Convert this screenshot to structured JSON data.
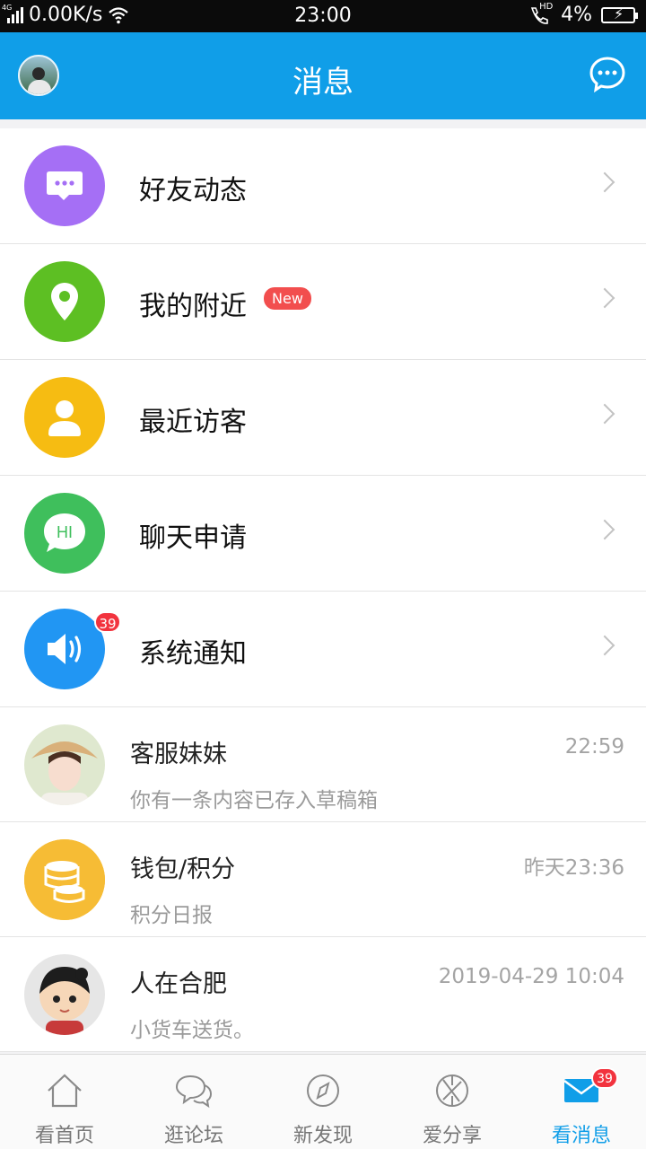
{
  "status_bar": {
    "network": "4G",
    "speed": "0.00K/s",
    "time": "23:00",
    "hd": "HD",
    "battery": "4%"
  },
  "header": {
    "title": "消息",
    "left_icon": "avatar",
    "right_icon": "chat-bubble-icon"
  },
  "features": [
    {
      "label": "好友动态",
      "icon": "speech-bubble-icon",
      "color": "#a56ff5"
    },
    {
      "label": "我的附近",
      "icon": "location-pin-icon",
      "color": "#5dbf23",
      "badge": "New"
    },
    {
      "label": "最近访客",
      "icon": "person-icon",
      "color": "#f6bc12"
    },
    {
      "label": "聊天申请",
      "icon": "hi-bubble-icon",
      "color": "#3fbf5c",
      "icon_text": "HI"
    },
    {
      "label": "系统通知",
      "icon": "speaker-icon",
      "color": "#2196f3",
      "badge": "39"
    }
  ],
  "messages": [
    {
      "name": "客服妹妹",
      "preview": "你有一条内容已存入草稿箱",
      "time": "22:59"
    },
    {
      "name": "钱包/积分",
      "preview": "积分日报",
      "time": "昨天23:36"
    },
    {
      "name": "人在合肥",
      "preview": "小货车送货。",
      "time": "2019-04-29 10:04"
    }
  ],
  "tabs": [
    {
      "label": "看首页",
      "icon": "home-icon"
    },
    {
      "label": "逛论坛",
      "icon": "forum-icon"
    },
    {
      "label": "新发现",
      "icon": "compass-icon"
    },
    {
      "label": "爱分享",
      "icon": "share-icon"
    },
    {
      "label": "看消息",
      "icon": "mail-icon",
      "badge": "39",
      "active": true
    }
  ],
  "colors": {
    "accent": "#109ee8",
    "badge_red": "#f2333e"
  }
}
